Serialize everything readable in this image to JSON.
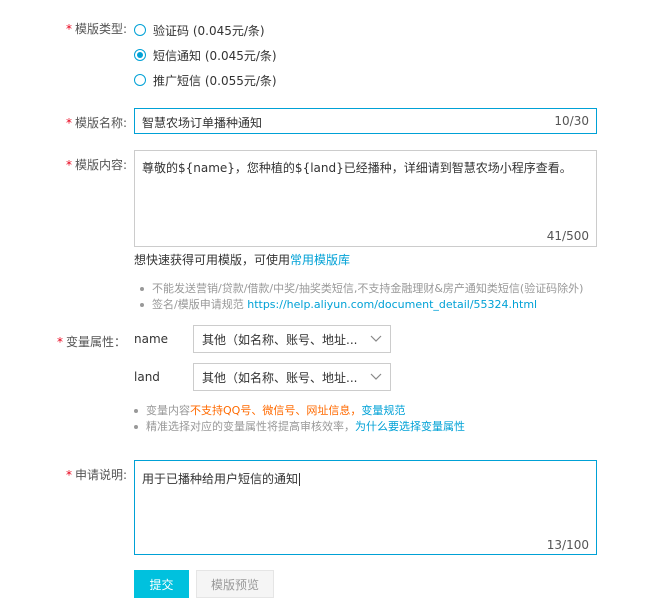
{
  "template_type": {
    "label": "模版类型:",
    "options": [
      {
        "label": "验证码 (0.045元/条)",
        "checked": false
      },
      {
        "label": "短信通知 (0.045元/条)",
        "checked": true
      },
      {
        "label": "推广短信 (0.055元/条)",
        "checked": false
      }
    ]
  },
  "template_name": {
    "label": "模版名称:",
    "value": "智慧农场订单播种通知",
    "counter": "10/30"
  },
  "template_content": {
    "label": "模版内容:",
    "value": "尊敬的${name}，您种植的${land}已经播种，详细请到智慧农场小程序查看。",
    "counter": "41/500",
    "quick_text": "想快速获得可用模版，可使用",
    "quick_link": "常用模版库",
    "hints": [
      "不能发送营销/贷款/借款/中奖/抽奖类短信,不支持金融理财&房产通知类短信(验证码除外)"
    ],
    "sign_hint": "签名/模版申请规范",
    "sign_link": "https://help.aliyun.com/document_detail/55324.html"
  },
  "variables": {
    "label": "变量属性：",
    "items": [
      {
        "name": "name",
        "value": "其他（如名称、账号、地址..."
      },
      {
        "name": "land",
        "value": "其他（如名称、账号、地址..."
      }
    ],
    "hint1_prefix": "变量内容",
    "hint1_orange": "不支持QQ号、微信号、网址信息，",
    "hint1_link": "变量规范",
    "hint2_text": "精准选择对应的变量属性将提高审核效率，",
    "hint2_link": "为什么要选择变量属性"
  },
  "description": {
    "label": "申请说明:",
    "value": "用于已播种给用户短信的通知",
    "counter": "13/100"
  },
  "buttons": {
    "submit": "提交",
    "preview": "模版预览"
  },
  "colors": {
    "accent": "#00a1d6",
    "primary_button": "#00c1de",
    "required": "#e9001a",
    "warning": "#ff6a00"
  }
}
